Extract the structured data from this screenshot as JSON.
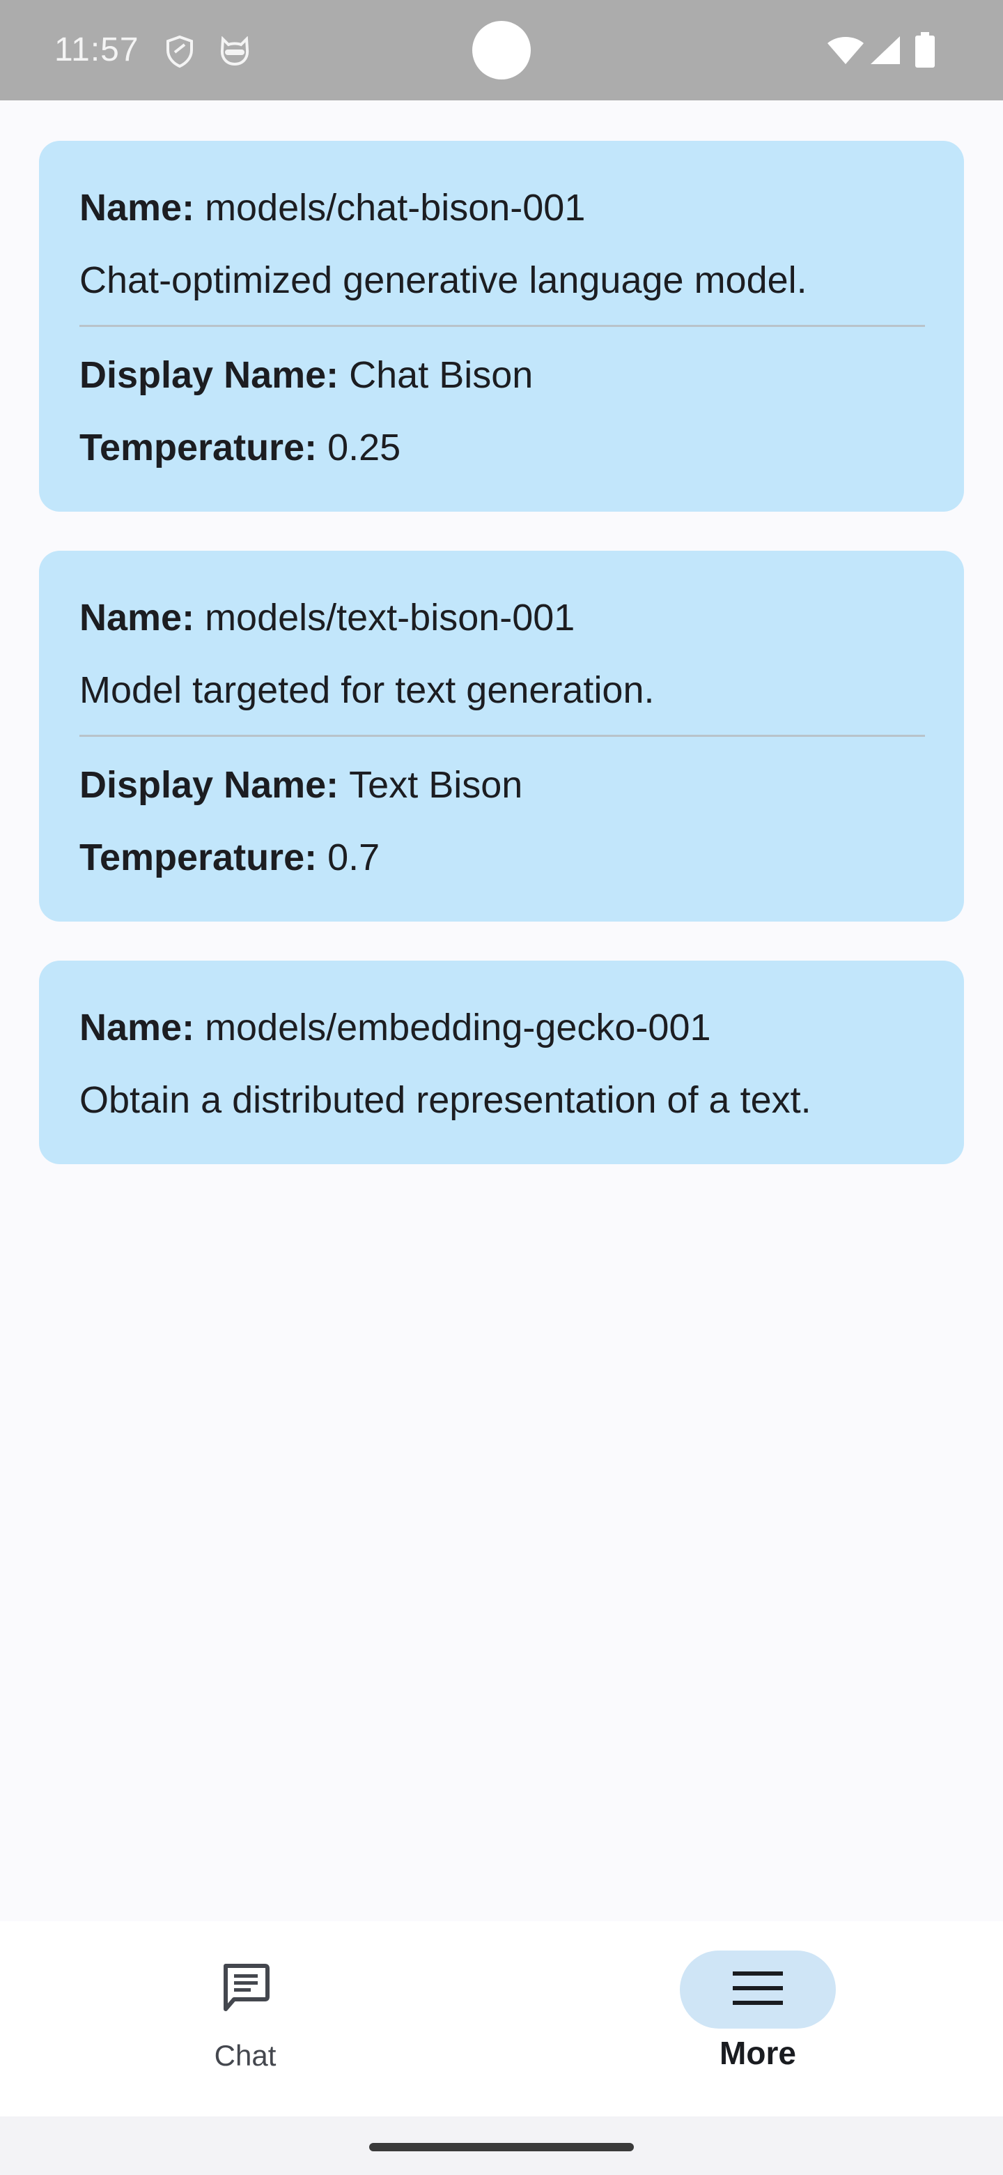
{
  "status_bar": {
    "time": "11:57",
    "icons": [
      "shield-icon",
      "cat-face-icon",
      "wifi-icon",
      "signal-icon",
      "battery-icon"
    ]
  },
  "labels": {
    "name": "Name:",
    "display_name": "Display Name:",
    "temperature": "Temperature:"
  },
  "models": [
    {
      "name": "models/chat-bison-001",
      "description": "Chat-optimized generative language model.",
      "display_name": "Chat Bison",
      "temperature": "0.25"
    },
    {
      "name": "models/text-bison-001",
      "description": "Model targeted for text generation.",
      "display_name": "Text Bison",
      "temperature": "0.7"
    },
    {
      "name": "models/embedding-gecko-001",
      "description": "Obtain a distributed representation of a text."
    }
  ],
  "bottom_nav": {
    "items": [
      {
        "label": "Chat",
        "icon": "chat-icon",
        "selected": false
      },
      {
        "label": "More",
        "icon": "menu-icon",
        "selected": true
      }
    ]
  },
  "colors": {
    "card_background": "#c2e6fb",
    "status_bar": "#acacac",
    "page_background": "#fafafd",
    "nav_active_indicator": "#cfe5f6"
  }
}
